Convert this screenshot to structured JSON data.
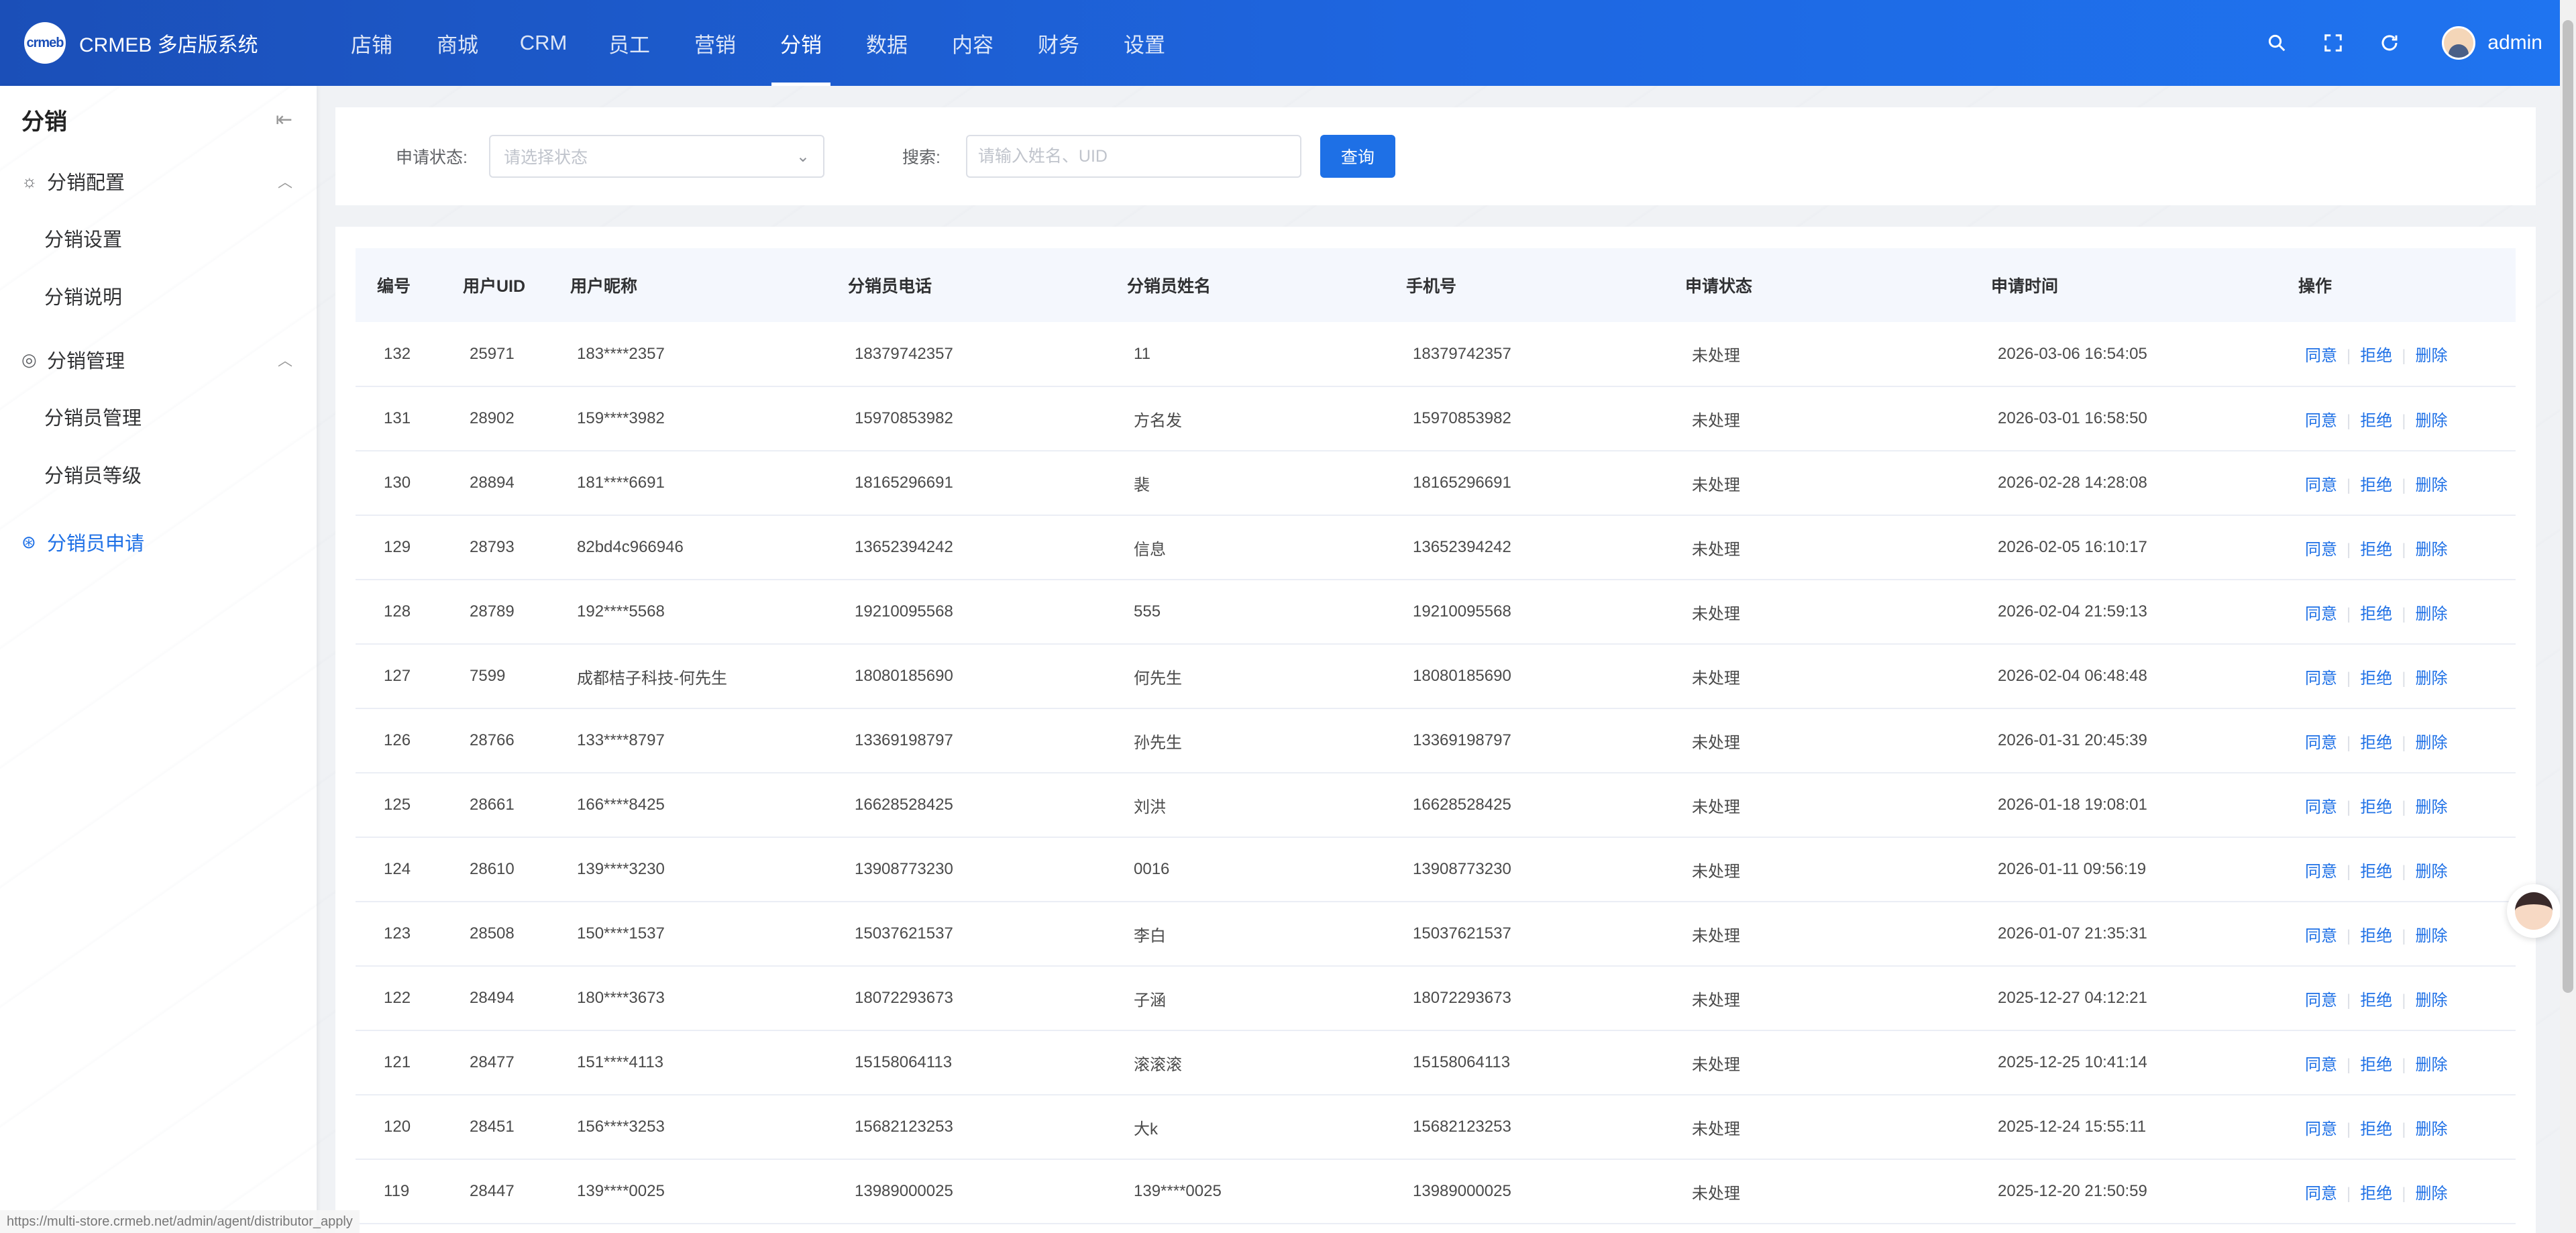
{
  "header": {
    "brand_logo_text": "crmeb",
    "brand_name": "CRMEB 多店版系统",
    "nav": [
      "店铺",
      "商城",
      "CRM",
      "员工",
      "营销",
      "分销",
      "数据",
      "内容",
      "财务",
      "设置"
    ],
    "active_nav": "分销",
    "user_name": "admin"
  },
  "sidebar": {
    "title": "分销",
    "groups": [
      {
        "label": "分销配置",
        "items": [
          "分销设置",
          "分销说明"
        ]
      },
      {
        "label": "分销管理",
        "items": [
          "分销员管理",
          "分销员等级"
        ]
      }
    ],
    "active_item": "分销员申请"
  },
  "filter": {
    "status_label": "申请状态:",
    "status_placeholder": "请选择状态",
    "search_label": "搜索:",
    "search_placeholder": "请输入姓名、UID",
    "query_button": "查询"
  },
  "table": {
    "columns": [
      "编号",
      "用户UID",
      "用户昵称",
      "分销员电话",
      "分销员姓名",
      "手机号",
      "申请状态",
      "申请时间",
      "操作"
    ],
    "actions": [
      "同意",
      "拒绝",
      "删除"
    ],
    "rows": [
      [
        "132",
        "25971",
        "183****2357",
        "18379742357",
        "11",
        "18379742357",
        "未处理",
        "2026-03-06 16:54:05"
      ],
      [
        "131",
        "28902",
        "159****3982",
        "15970853982",
        "方名发",
        "15970853982",
        "未处理",
        "2026-03-01 16:58:50"
      ],
      [
        "130",
        "28894",
        "181****6691",
        "18165296691",
        "裴",
        "18165296691",
        "未处理",
        "2026-02-28 14:28:08"
      ],
      [
        "129",
        "28793",
        "82bd4c966946",
        "13652394242",
        "信息",
        "13652394242",
        "未处理",
        "2026-02-05 16:10:17"
      ],
      [
        "128",
        "28789",
        "192****5568",
        "19210095568",
        "555",
        "19210095568",
        "未处理",
        "2026-02-04 21:59:13"
      ],
      [
        "127",
        "7599",
        "成都桔子科技-何先生",
        "18080185690",
        "何先生",
        "18080185690",
        "未处理",
        "2026-02-04 06:48:48"
      ],
      [
        "126",
        "28766",
        "133****8797",
        "13369198797",
        "孙先生",
        "13369198797",
        "未处理",
        "2026-01-31 20:45:39"
      ],
      [
        "125",
        "28661",
        "166****8425",
        "16628528425",
        "刘洪",
        "16628528425",
        "未处理",
        "2026-01-18 19:08:01"
      ],
      [
        "124",
        "28610",
        "139****3230",
        "13908773230",
        "0016",
        "13908773230",
        "未处理",
        "2026-01-11 09:56:19"
      ],
      [
        "123",
        "28508",
        "150****1537",
        "15037621537",
        "李白",
        "15037621537",
        "未处理",
        "2026-01-07 21:35:31"
      ],
      [
        "122",
        "28494",
        "180****3673",
        "18072293673",
        "子涵",
        "18072293673",
        "未处理",
        "2025-12-27 04:12:21"
      ],
      [
        "121",
        "28477",
        "151****4113",
        "15158064113",
        "滚滚滚",
        "15158064113",
        "未处理",
        "2025-12-25 10:41:14"
      ],
      [
        "120",
        "28451",
        "156****3253",
        "15682123253",
        "大k",
        "15682123253",
        "未处理",
        "2025-12-24 15:55:11"
      ],
      [
        "119",
        "28447",
        "139****0025",
        "13989000025",
        "139****0025",
        "13989000025",
        "未处理",
        "2025-12-20 21:50:59"
      ]
    ]
  },
  "status_url": "https://multi-store.crmeb.net/admin/agent/distributor_apply",
  "colors": {
    "primary": "#1e70e6",
    "header_start": "#1b4fb8",
    "header_end": "#1f74f0"
  }
}
